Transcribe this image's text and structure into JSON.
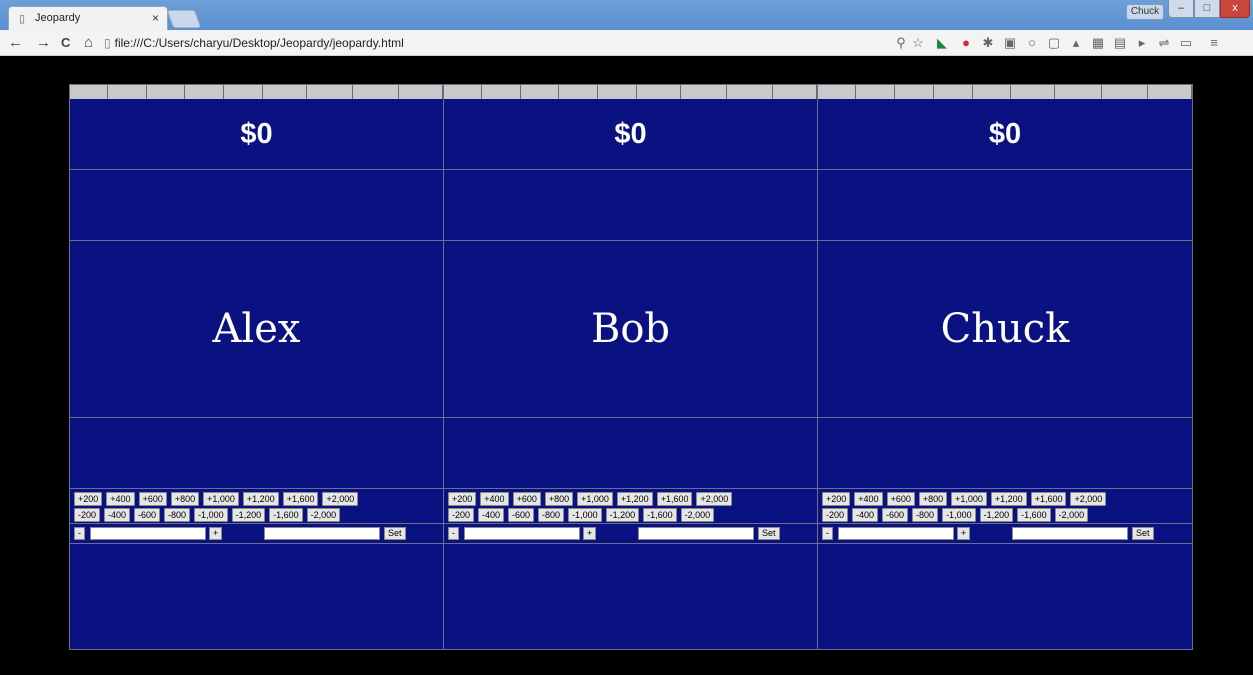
{
  "browser": {
    "tab_title": "Jeopardy",
    "tab_close": "×",
    "profile_name": "Chuck",
    "url": "file:///C:/Users/charyu/Desktop/Jeopardy/jeopardy.html",
    "nav": {
      "back": "←",
      "forward": "→",
      "reload": "C",
      "home": "⌂"
    },
    "window": {
      "minimize": "–",
      "maximize": "□",
      "close": "x"
    }
  },
  "players": [
    {
      "name": "Alex",
      "score": "$0"
    },
    {
      "name": "Bob",
      "score": "$0"
    },
    {
      "name": "Chuck",
      "score": "$0"
    }
  ],
  "plus_buttons": [
    "+200",
    "+400",
    "+600",
    "+800",
    "+1,000",
    "+1,200",
    "+1,600",
    "+2,000"
  ],
  "minus_buttons": [
    "-200",
    "-400",
    "-600",
    "-800",
    "-1,000",
    "-1,200",
    "-1,600",
    "-2,000"
  ],
  "controls": {
    "decrement": "-",
    "increment": "+",
    "set": "Set"
  },
  "colors": {
    "board": "#0a1281",
    "border": "#6d6f8a",
    "light": "#c9c9c9"
  }
}
